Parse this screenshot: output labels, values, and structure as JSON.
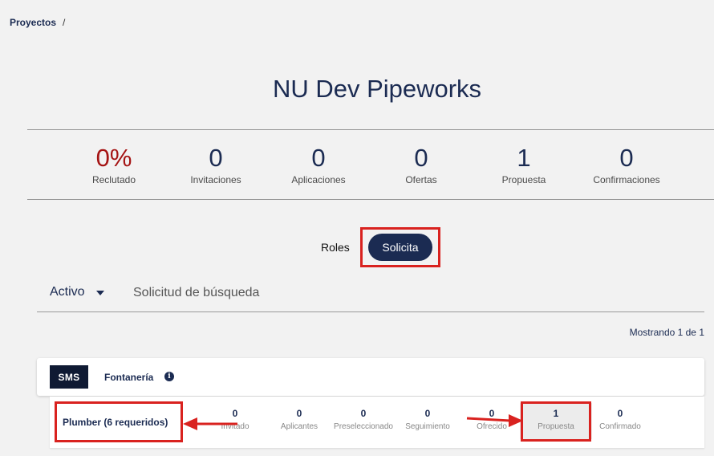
{
  "breadcrumb": {
    "item": "Proyectos",
    "separator": "/"
  },
  "page": {
    "title": "NU Dev Pipeworks"
  },
  "stats": [
    {
      "value": "0%",
      "label": "Reclutado"
    },
    {
      "value": "0",
      "label": "Invitaciones"
    },
    {
      "value": "0",
      "label": "Aplicaciones"
    },
    {
      "value": "0",
      "label": "Ofertas"
    },
    {
      "value": "1",
      "label": "Propuesta"
    },
    {
      "value": "0",
      "label": "Confirmaciones"
    }
  ],
  "toggle": {
    "roles_label": "Roles",
    "solicita_label": "Solicita"
  },
  "filter": {
    "status": "Activo",
    "search_placeholder": "Solicitud de búsqueda"
  },
  "results": {
    "showing": "Mostrando 1 de 1"
  },
  "card": {
    "badge": "SMS",
    "name": "Fontanería",
    "info_icon": "i"
  },
  "role_row": {
    "name": "Plumber (6 requeridos)",
    "pipeline": [
      {
        "value": "0",
        "label": "Invitado"
      },
      {
        "value": "0",
        "label": "Aplicantes"
      },
      {
        "value": "0",
        "label": "Preseleccionado"
      },
      {
        "value": "0",
        "label": "Seguimiento"
      },
      {
        "value": "0",
        "label": "Ofrecido"
      },
      {
        "value": "1",
        "label": "Propuesta"
      },
      {
        "value": "0",
        "label": "Confirmado"
      }
    ]
  },
  "colors": {
    "navy": "#1b2b52",
    "recruited_red": "#a51414",
    "annotation_red": "#d9221f"
  }
}
